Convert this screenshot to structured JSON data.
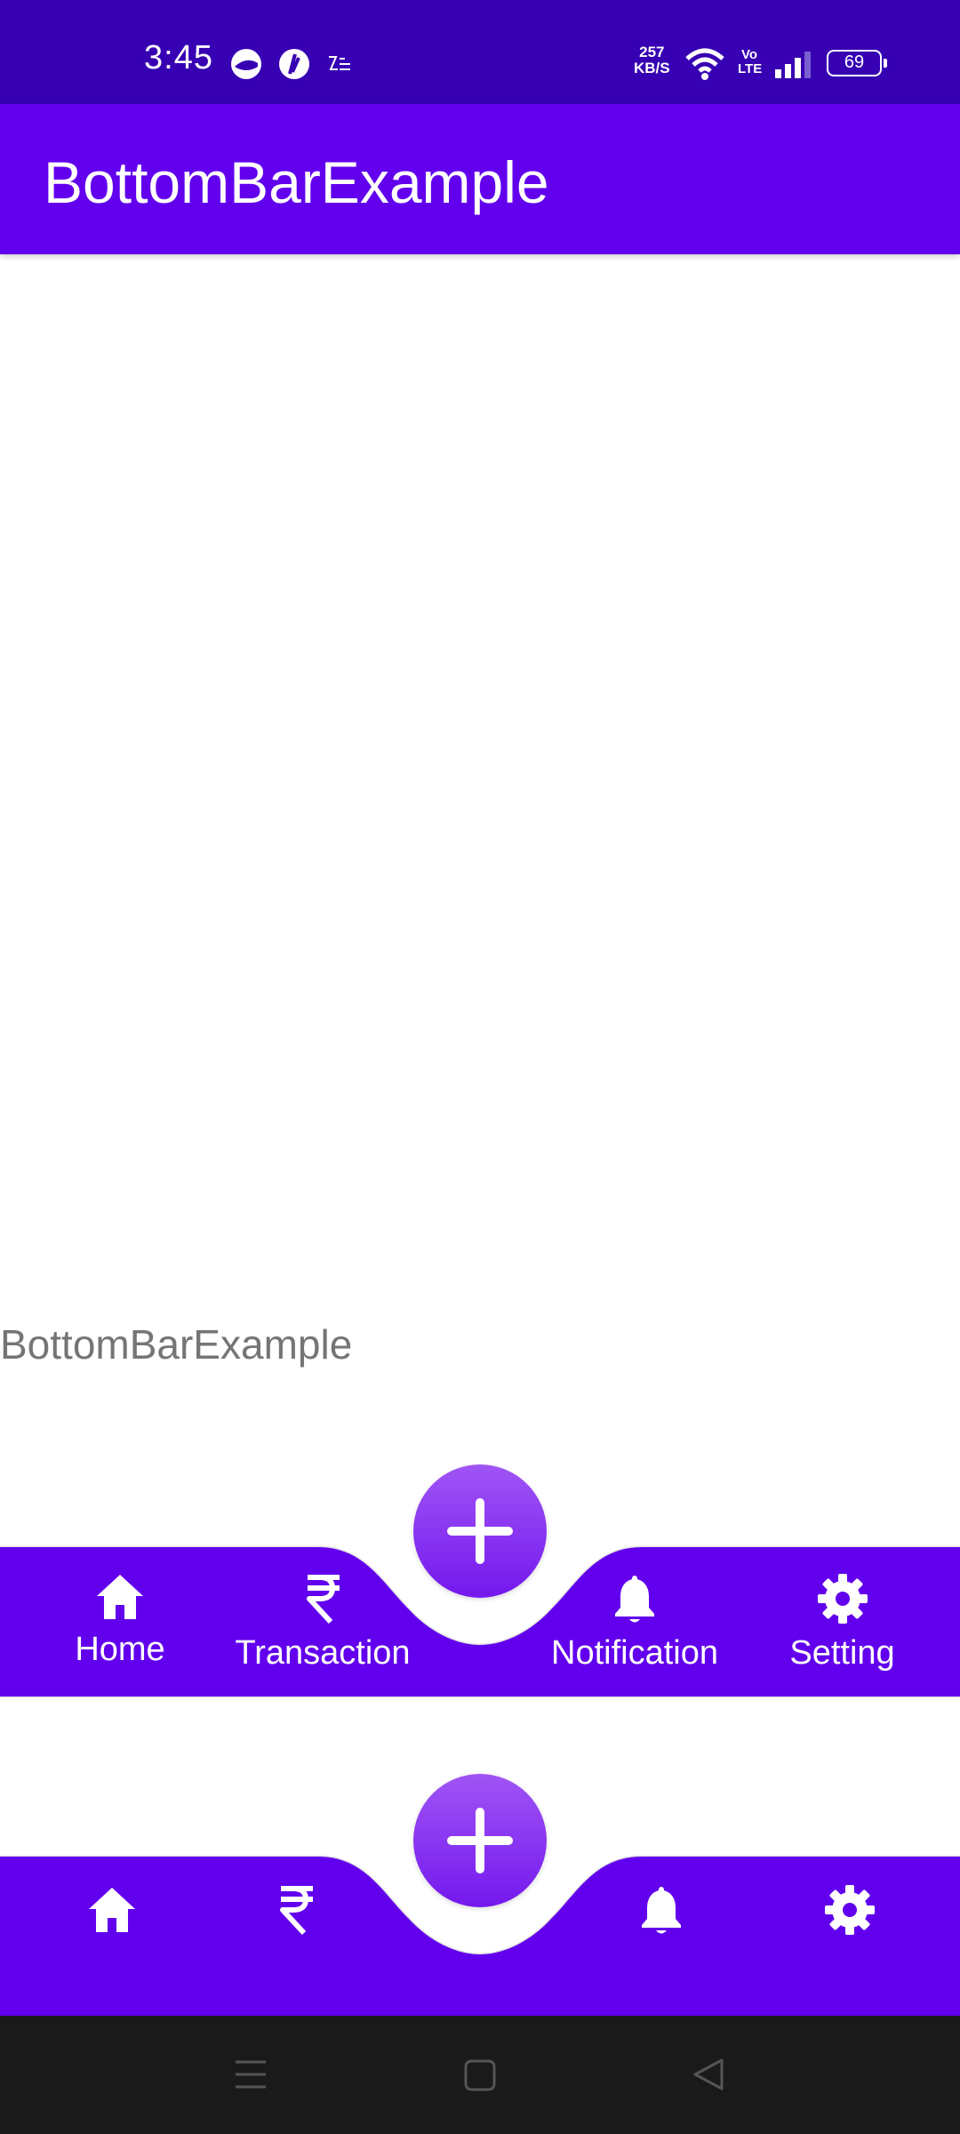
{
  "status_bar": {
    "time": "3:45",
    "net_speed_value": "257",
    "net_speed_unit": "KB/S",
    "volte": "Vo LTE",
    "battery": "69",
    "colors": {
      "background": "#3700B3"
    }
  },
  "app_bar": {
    "title": "BottomBarExample",
    "color": "#6200EE"
  },
  "content": {
    "text": "BottomBarExample"
  },
  "bottom_bar_labeled": {
    "items": [
      {
        "label": "Home",
        "icon": "home-icon"
      },
      {
        "label": "Transaction",
        "icon": "rupee-icon"
      },
      {
        "label": "Notification",
        "icon": "bell-icon"
      },
      {
        "label": "Setting",
        "icon": "gear-icon"
      }
    ],
    "fab_icon": "plus-icon"
  },
  "bottom_bar_icons": {
    "items": [
      {
        "icon": "home-icon"
      },
      {
        "icon": "rupee-icon"
      },
      {
        "icon": "bell-icon"
      },
      {
        "icon": "gear-icon"
      }
    ],
    "fab_icon": "plus-icon"
  },
  "system_nav": {
    "buttons": [
      "menu-icon",
      "home-square-icon",
      "back-triangle-icon"
    ]
  }
}
